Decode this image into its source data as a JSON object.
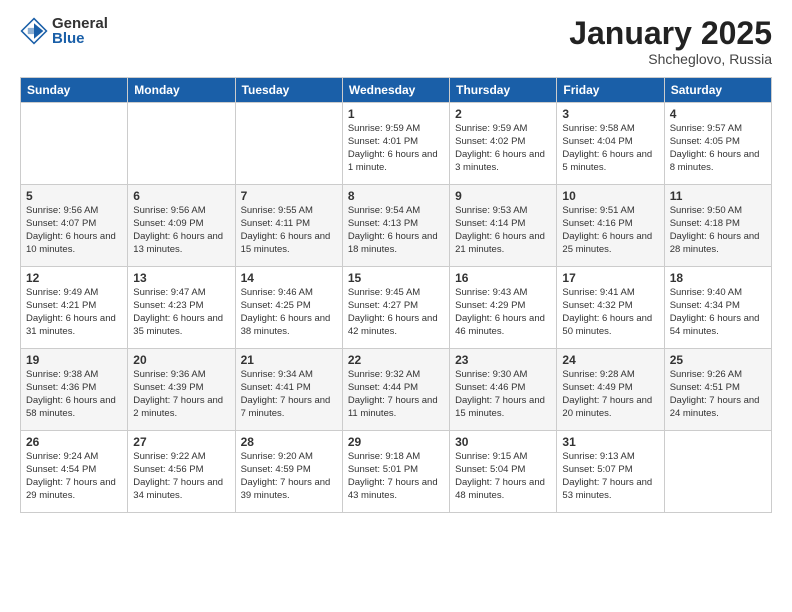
{
  "logo": {
    "general": "General",
    "blue": "Blue"
  },
  "title": "January 2025",
  "subtitle": "Shcheglovo, Russia",
  "headers": [
    "Sunday",
    "Monday",
    "Tuesday",
    "Wednesday",
    "Thursday",
    "Friday",
    "Saturday"
  ],
  "weeks": [
    [
      {
        "day": "",
        "info": ""
      },
      {
        "day": "",
        "info": ""
      },
      {
        "day": "",
        "info": ""
      },
      {
        "day": "1",
        "info": "Sunrise: 9:59 AM\nSunset: 4:01 PM\nDaylight: 6 hours and 1 minute."
      },
      {
        "day": "2",
        "info": "Sunrise: 9:59 AM\nSunset: 4:02 PM\nDaylight: 6 hours and 3 minutes."
      },
      {
        "day": "3",
        "info": "Sunrise: 9:58 AM\nSunset: 4:04 PM\nDaylight: 6 hours and 5 minutes."
      },
      {
        "day": "4",
        "info": "Sunrise: 9:57 AM\nSunset: 4:05 PM\nDaylight: 6 hours and 8 minutes."
      }
    ],
    [
      {
        "day": "5",
        "info": "Sunrise: 9:56 AM\nSunset: 4:07 PM\nDaylight: 6 hours and 10 minutes."
      },
      {
        "day": "6",
        "info": "Sunrise: 9:56 AM\nSunset: 4:09 PM\nDaylight: 6 hours and 13 minutes."
      },
      {
        "day": "7",
        "info": "Sunrise: 9:55 AM\nSunset: 4:11 PM\nDaylight: 6 hours and 15 minutes."
      },
      {
        "day": "8",
        "info": "Sunrise: 9:54 AM\nSunset: 4:13 PM\nDaylight: 6 hours and 18 minutes."
      },
      {
        "day": "9",
        "info": "Sunrise: 9:53 AM\nSunset: 4:14 PM\nDaylight: 6 hours and 21 minutes."
      },
      {
        "day": "10",
        "info": "Sunrise: 9:51 AM\nSunset: 4:16 PM\nDaylight: 6 hours and 25 minutes."
      },
      {
        "day": "11",
        "info": "Sunrise: 9:50 AM\nSunset: 4:18 PM\nDaylight: 6 hours and 28 minutes."
      }
    ],
    [
      {
        "day": "12",
        "info": "Sunrise: 9:49 AM\nSunset: 4:21 PM\nDaylight: 6 hours and 31 minutes."
      },
      {
        "day": "13",
        "info": "Sunrise: 9:47 AM\nSunset: 4:23 PM\nDaylight: 6 hours and 35 minutes."
      },
      {
        "day": "14",
        "info": "Sunrise: 9:46 AM\nSunset: 4:25 PM\nDaylight: 6 hours and 38 minutes."
      },
      {
        "day": "15",
        "info": "Sunrise: 9:45 AM\nSunset: 4:27 PM\nDaylight: 6 hours and 42 minutes."
      },
      {
        "day": "16",
        "info": "Sunrise: 9:43 AM\nSunset: 4:29 PM\nDaylight: 6 hours and 46 minutes."
      },
      {
        "day": "17",
        "info": "Sunrise: 9:41 AM\nSunset: 4:32 PM\nDaylight: 6 hours and 50 minutes."
      },
      {
        "day": "18",
        "info": "Sunrise: 9:40 AM\nSunset: 4:34 PM\nDaylight: 6 hours and 54 minutes."
      }
    ],
    [
      {
        "day": "19",
        "info": "Sunrise: 9:38 AM\nSunset: 4:36 PM\nDaylight: 6 hours and 58 minutes."
      },
      {
        "day": "20",
        "info": "Sunrise: 9:36 AM\nSunset: 4:39 PM\nDaylight: 7 hours and 2 minutes."
      },
      {
        "day": "21",
        "info": "Sunrise: 9:34 AM\nSunset: 4:41 PM\nDaylight: 7 hours and 7 minutes."
      },
      {
        "day": "22",
        "info": "Sunrise: 9:32 AM\nSunset: 4:44 PM\nDaylight: 7 hours and 11 minutes."
      },
      {
        "day": "23",
        "info": "Sunrise: 9:30 AM\nSunset: 4:46 PM\nDaylight: 7 hours and 15 minutes."
      },
      {
        "day": "24",
        "info": "Sunrise: 9:28 AM\nSunset: 4:49 PM\nDaylight: 7 hours and 20 minutes."
      },
      {
        "day": "25",
        "info": "Sunrise: 9:26 AM\nSunset: 4:51 PM\nDaylight: 7 hours and 24 minutes."
      }
    ],
    [
      {
        "day": "26",
        "info": "Sunrise: 9:24 AM\nSunset: 4:54 PM\nDaylight: 7 hours and 29 minutes."
      },
      {
        "day": "27",
        "info": "Sunrise: 9:22 AM\nSunset: 4:56 PM\nDaylight: 7 hours and 34 minutes."
      },
      {
        "day": "28",
        "info": "Sunrise: 9:20 AM\nSunset: 4:59 PM\nDaylight: 7 hours and 39 minutes."
      },
      {
        "day": "29",
        "info": "Sunrise: 9:18 AM\nSunset: 5:01 PM\nDaylight: 7 hours and 43 minutes."
      },
      {
        "day": "30",
        "info": "Sunrise: 9:15 AM\nSunset: 5:04 PM\nDaylight: 7 hours and 48 minutes."
      },
      {
        "day": "31",
        "info": "Sunrise: 9:13 AM\nSunset: 5:07 PM\nDaylight: 7 hours and 53 minutes."
      },
      {
        "day": "",
        "info": ""
      }
    ]
  ]
}
